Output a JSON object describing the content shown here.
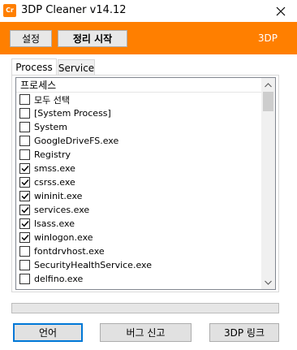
{
  "window": {
    "title": "3DP Cleaner v14.12",
    "icon_text": "Cr"
  },
  "toolbar": {
    "settings_label": "설정",
    "start_label": "정리 시작",
    "brand": "3DP"
  },
  "tabs": [
    {
      "label": "Process",
      "active": true
    },
    {
      "label": "Service",
      "active": false
    }
  ],
  "list": {
    "header": "프로세스",
    "items": [
      {
        "label": "모두 선택",
        "checked": false
      },
      {
        "label": "[System Process]",
        "checked": false
      },
      {
        "label": "System",
        "checked": false
      },
      {
        "label": "GoogleDriveFS.exe",
        "checked": false
      },
      {
        "label": "Registry",
        "checked": false
      },
      {
        "label": "smss.exe",
        "checked": true
      },
      {
        "label": "csrss.exe",
        "checked": true
      },
      {
        "label": "wininit.exe",
        "checked": true
      },
      {
        "label": "services.exe",
        "checked": true
      },
      {
        "label": "lsass.exe",
        "checked": true
      },
      {
        "label": "winlogon.exe",
        "checked": true
      },
      {
        "label": "fontdrvhost.exe",
        "checked": false
      },
      {
        "label": "SecurityHealthService.exe",
        "checked": false
      },
      {
        "label": "delfino.exe",
        "checked": false
      }
    ]
  },
  "progress": {
    "value": 0
  },
  "footer": {
    "lang_label": "언어",
    "bug_label": "버그 신고",
    "link_label": "3DP 링크"
  },
  "colors": {
    "accent": "#ff7f00",
    "focus": "#0078d7"
  }
}
